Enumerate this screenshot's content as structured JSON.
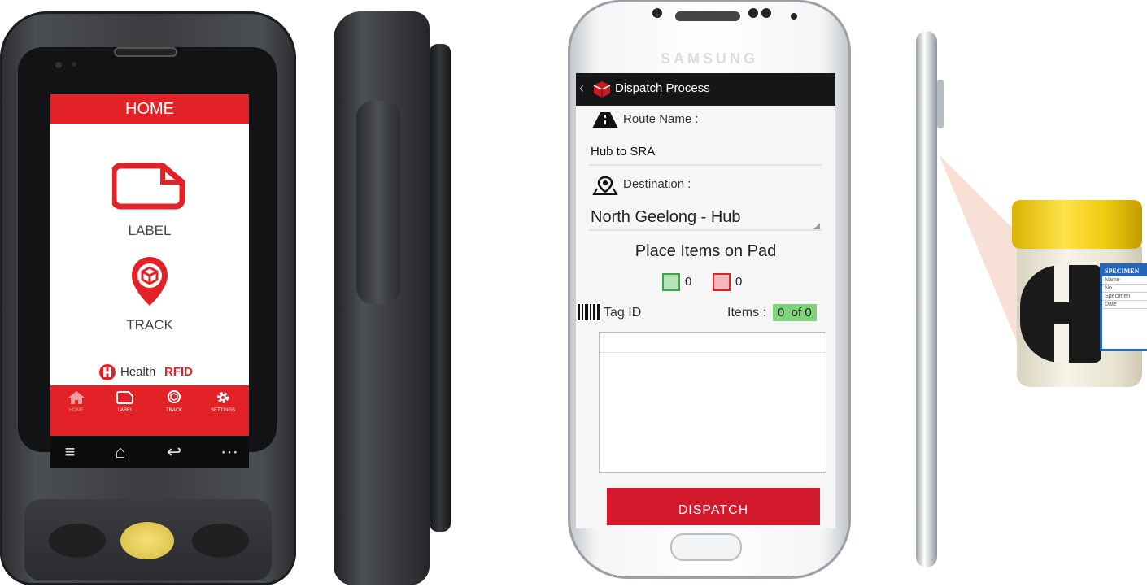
{
  "rugged_device": {
    "header_title": "HOME",
    "main_items": [
      {
        "label": "LABEL",
        "icon": "label-tag-icon"
      },
      {
        "label": "TRACK",
        "icon": "track-pin-icon"
      }
    ],
    "brand": {
      "prefix": "Health",
      "suffix": "RFID",
      "icon": "healthrfid-logo-icon"
    },
    "bottom_tabs": [
      {
        "label": "HOME",
        "icon": "home-icon"
      },
      {
        "label": "LABEL",
        "icon": "label-tag-icon"
      },
      {
        "label": "TRACK",
        "icon": "track-pin-icon"
      },
      {
        "label": "SETTINGS",
        "icon": "gear-icon"
      }
    ],
    "nav_buttons": [
      "menu-icon",
      "home-outline-icon",
      "back-icon",
      "more-icon"
    ],
    "accent_color": "#e32228"
  },
  "samsung_phone": {
    "brand_text": "SAMSUNG",
    "action_bar": {
      "back_glyph": "‹",
      "title": "Dispatch Process",
      "icon": "app-box-icon"
    },
    "route": {
      "label": "Route Name :",
      "value": "Hub to SRA",
      "icon": "road-icon"
    },
    "destination": {
      "label": "Destination :",
      "value": "North Geelong - Hub",
      "icon": "map-pin-icon"
    },
    "pad_instruction": "Place Items on Pad",
    "counts": [
      {
        "value": "0",
        "color": "#3aa84a",
        "icon": "rfid-green-icon"
      },
      {
        "value": "0",
        "color": "#e32228",
        "icon": "rfid-red-icon"
      }
    ],
    "tag_header": {
      "label": "Tag ID",
      "icon": "barcode-icon"
    },
    "items_label": "Items :",
    "items_value": "0  of 0",
    "dispatch_button": "DISPATCH",
    "accent_color": "#d31a2d"
  },
  "specimen_jar": {
    "label_title": "SPECIMEN",
    "label_rows": [
      "Name",
      "No.",
      "Specimen",
      "Date"
    ]
  }
}
